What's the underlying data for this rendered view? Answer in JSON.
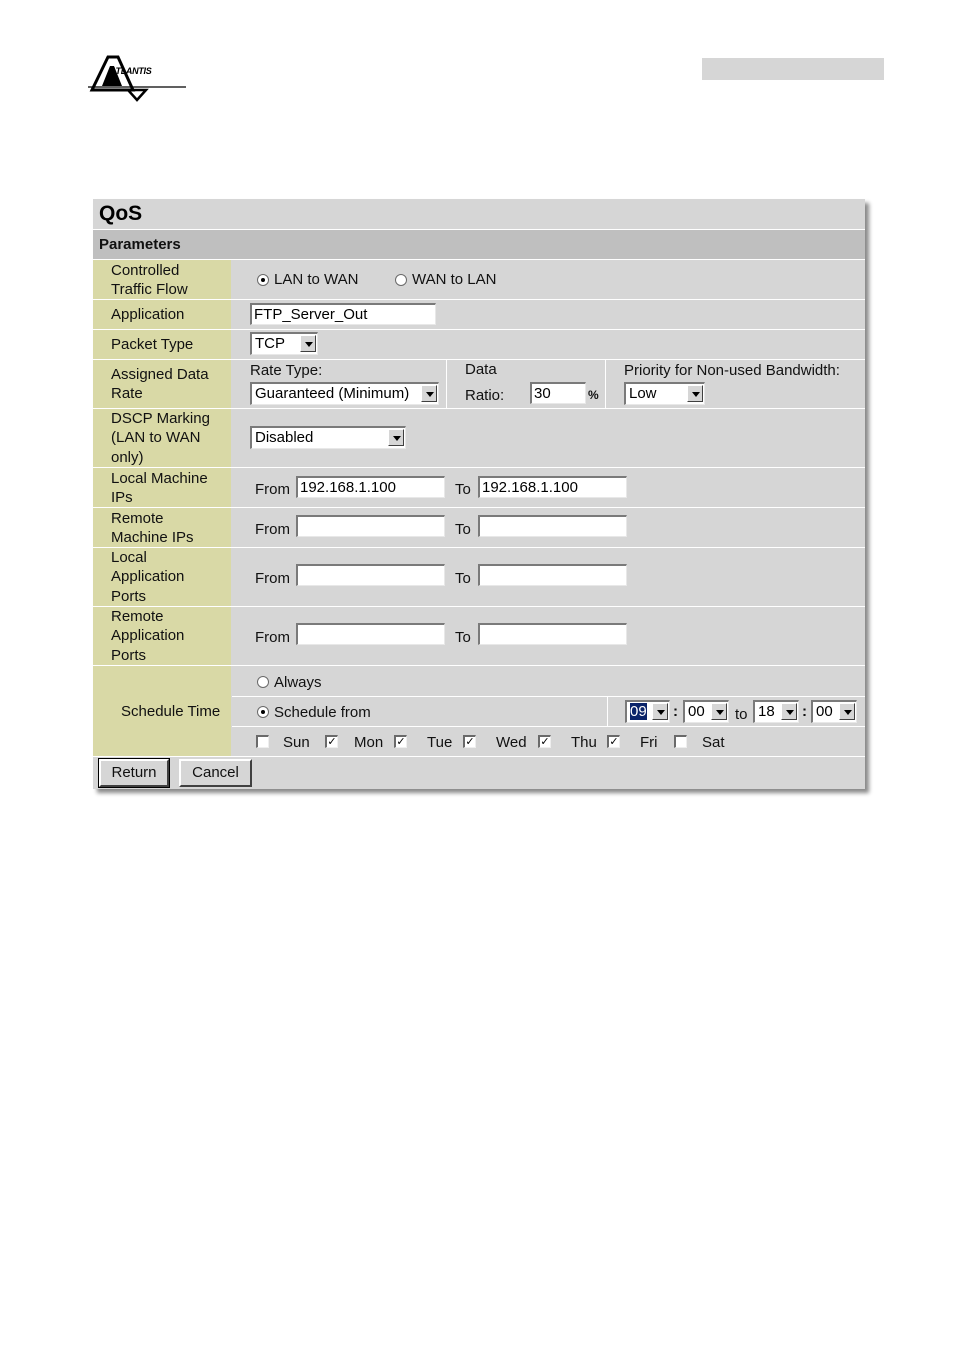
{
  "brand": {
    "logo_text": "ATLANTIS"
  },
  "panel": {
    "title": "QoS",
    "section": "Parameters"
  },
  "controlled_traffic_flow": {
    "label_line1": "Controlled",
    "label_line2": "Traffic Flow",
    "options": [
      "LAN to WAN",
      "WAN to LAN"
    ],
    "selected": "LAN to WAN"
  },
  "application": {
    "label": "Application",
    "value": "FTP_Server_Out"
  },
  "packet_type": {
    "label": "Packet Type",
    "value": "TCP"
  },
  "assigned_data_rate": {
    "label_line1": "Assigned Data",
    "label_line2": "Rate",
    "rate_type_label": "Rate Type:",
    "rate_type_value": "Guaranteed (Minimum)",
    "data_label": "Data",
    "ratio_label": "Ratio:",
    "ratio_value": "30",
    "ratio_unit": "%",
    "priority_label": "Priority for Non-used Bandwidth:",
    "priority_value": "Low"
  },
  "dscp_marking": {
    "label_line1": "DSCP Marking",
    "label_line2": "(LAN to WAN",
    "label_line3": "only)",
    "value": "Disabled"
  },
  "local_machine_ips": {
    "label_line1": "Local Machine",
    "label_line2": "IPs",
    "from_label": "From",
    "from_value": "192.168.1.100",
    "to_label": "To",
    "to_value": "192.168.1.100"
  },
  "remote_machine_ips": {
    "label_line1": "Remote",
    "label_line2": "Machine IPs",
    "from_label": "From",
    "from_value": "",
    "to_label": "To",
    "to_value": ""
  },
  "local_application_ports": {
    "label_line1": "Local",
    "label_line2": "Application",
    "label_line3": "Ports",
    "from_label": "From",
    "from_value": "",
    "to_label": "To",
    "to_value": ""
  },
  "remote_application_ports": {
    "label_line1": "Remote",
    "label_line2": "Application",
    "label_line3": "Ports",
    "from_label": "From",
    "from_value": "",
    "to_label": "To",
    "to_value": ""
  },
  "schedule": {
    "label": "Schedule Time",
    "always_label": "Always",
    "from_label": "Schedule from",
    "selected": "Schedule from",
    "start_hour": "09",
    "start_minute": "00",
    "to_label": "to",
    "end_hour": "18",
    "end_minute": "00",
    "colon": ":",
    "days": [
      {
        "name": "Sun",
        "checked": false
      },
      {
        "name": "Mon",
        "checked": true
      },
      {
        "name": "Tue",
        "checked": true
      },
      {
        "name": "Wed",
        "checked": true
      },
      {
        "name": "Thu",
        "checked": true
      },
      {
        "name": "Fri",
        "checked": true
      },
      {
        "name": "Sat",
        "checked": false
      }
    ]
  },
  "buttons": {
    "return_label": "Return",
    "cancel_label": "Cancel"
  }
}
